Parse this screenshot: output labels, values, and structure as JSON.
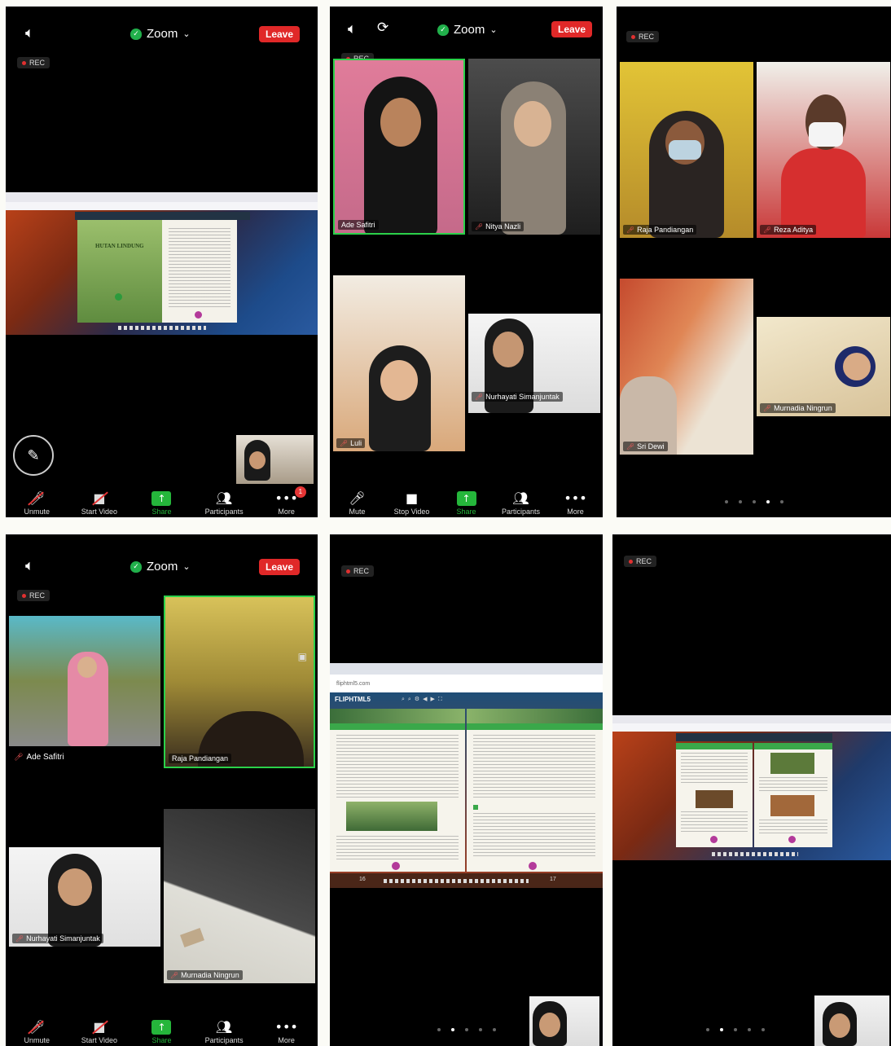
{
  "zoom_header": {
    "title": "Zoom",
    "leave": "Leave"
  },
  "rec_label": "REC",
  "toolbar_muted": {
    "unmute": "Unmute",
    "start_video": "Start Video",
    "share": "Share",
    "participants": "Participants",
    "more": "More",
    "more_badge": "1"
  },
  "toolbar_live": {
    "mute": "Mute",
    "stop_video": "Stop Video",
    "share": "Share",
    "participants": "Participants",
    "more": "More"
  },
  "panel1": {
    "book_left_title": "HUTAN LINDUNG"
  },
  "panel2": {
    "participants": [
      {
        "name": "Ade Safitri"
      },
      {
        "name": "Nitya Nazli"
      },
      {
        "name": "Luli"
      },
      {
        "name": "Nurhayati Simanjuntak"
      }
    ]
  },
  "panel3": {
    "participants": [
      {
        "name": "Raja Pandiangan"
      },
      {
        "name": "Reza Aditya"
      },
      {
        "name": "Sri Dewi"
      },
      {
        "name": "Murnadia Ningrun"
      }
    ],
    "page_dots": {
      "count": 5,
      "active": 3
    }
  },
  "panel4": {
    "participants": [
      {
        "name": "Ade Safitri"
      },
      {
        "name": "Raja Pandiangan"
      },
      {
        "name": "Nurhayati Simanjuntak"
      },
      {
        "name": "Murnadia Ningrun"
      }
    ]
  },
  "panel5": {
    "browser_url": "fliphtml5.com",
    "flip_logo": "FLIPHTML5",
    "page_left": "16",
    "page_right": "17",
    "page_dots": {
      "count": 5,
      "active": 1
    }
  },
  "panel6": {
    "page_dots": {
      "count": 5,
      "active": 1
    }
  },
  "colors": {
    "zoom_green": "#2bd14a",
    "leave_red": "#e02828",
    "share_green": "#25b63b",
    "rec_red": "#e03030"
  }
}
